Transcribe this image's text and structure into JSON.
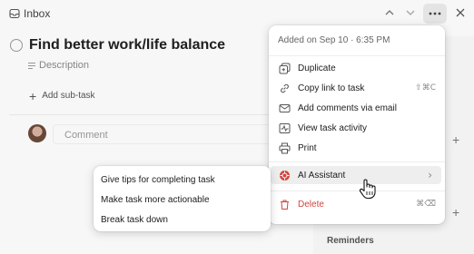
{
  "header": {
    "project": "Inbox",
    "icons": [
      "inbox-icon",
      "chevron-up-icon",
      "chevron-down-icon",
      "more-icon",
      "close-icon"
    ]
  },
  "task": {
    "title": "Find better work/life balance",
    "description_placeholder": "Description",
    "add_subtask": "Add sub-task",
    "comment_placeholder": "Comment"
  },
  "sidebar": {
    "reminders": "Reminders"
  },
  "menu": {
    "added": "Added on Sep 10 · 6:35 PM",
    "items": [
      {
        "label": "Duplicate",
        "icon": "duplicate-icon",
        "shortcut": ""
      },
      {
        "label": "Copy link to task",
        "icon": "link-icon",
        "shortcut": "⇧⌘C"
      },
      {
        "label": "Add comments via email",
        "icon": "email-icon",
        "shortcut": ""
      },
      {
        "label": "View task activity",
        "icon": "activity-icon",
        "shortcut": ""
      },
      {
        "label": "Print",
        "icon": "print-icon",
        "shortcut": ""
      },
      {
        "label": "AI Assistant",
        "icon": "ai-assistant-icon",
        "shortcut": "›"
      },
      {
        "label": "Delete",
        "icon": "trash-icon",
        "shortcut": "⌘⌫"
      }
    ]
  },
  "submenu": {
    "items": [
      "Give tips for completing task",
      "Make task more actionable",
      "Break task down"
    ]
  },
  "colors": {
    "accent": "#d1453b",
    "highlight": "#eeeeee"
  }
}
